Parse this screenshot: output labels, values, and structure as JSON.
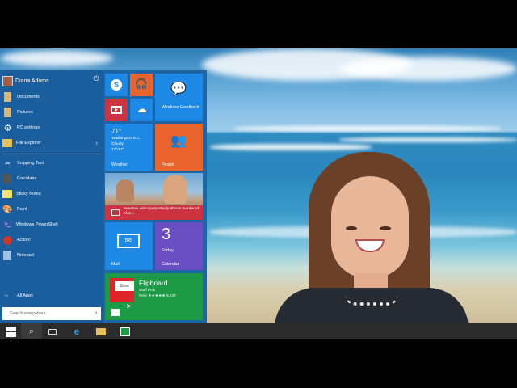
{
  "user": {
    "name": "Diana Adams"
  },
  "menu": {
    "items": [
      {
        "label": "Documents",
        "icon": "folder-documents-icon"
      },
      {
        "label": "Pictures",
        "icon": "folder-pictures-icon"
      },
      {
        "label": "PC settings",
        "icon": "gear-icon"
      },
      {
        "label": "File Explorer",
        "icon": "file-explorer-icon"
      },
      {
        "label": "Snipping Tool",
        "icon": "scissors-icon"
      },
      {
        "label": "Calculator",
        "icon": "calculator-icon"
      },
      {
        "label": "Sticky Notes",
        "icon": "sticky-notes-icon"
      },
      {
        "label": "Paint",
        "icon": "paint-icon"
      },
      {
        "label": "Windows PowerShell",
        "icon": "powershell-icon"
      },
      {
        "label": "Action!",
        "icon": "action-icon"
      },
      {
        "label": "Notepad",
        "icon": "notepad-icon"
      }
    ],
    "all_apps": "All Apps",
    "search_placeholder": "Search everywhere"
  },
  "tiles": {
    "feedback": "Windows Feedback",
    "weather": {
      "temp": "71°",
      "location": "Washington D.C.",
      "condition": "Cloudy",
      "range": "77°/67°",
      "label": "Weather"
    },
    "people": "People",
    "news": {
      "headline": "New Isis video purportedly shows murder of Alan..."
    },
    "mail": "Mail",
    "calendar": {
      "day": "3",
      "weekday": "Friday",
      "label": "Calendar"
    },
    "store": {
      "badge": "Store",
      "app": "Flipboard",
      "subtitle": "Staff Pick",
      "rating": "Free ★★★★★ 5,227"
    }
  },
  "colors": {
    "start_bg": "#1c66a8",
    "tile_blue": "#1e88e5",
    "tile_orange": "#e8642c",
    "tile_red": "#cc3340",
    "tile_purple": "#6a4fc4",
    "tile_green": "#1c9a46"
  }
}
